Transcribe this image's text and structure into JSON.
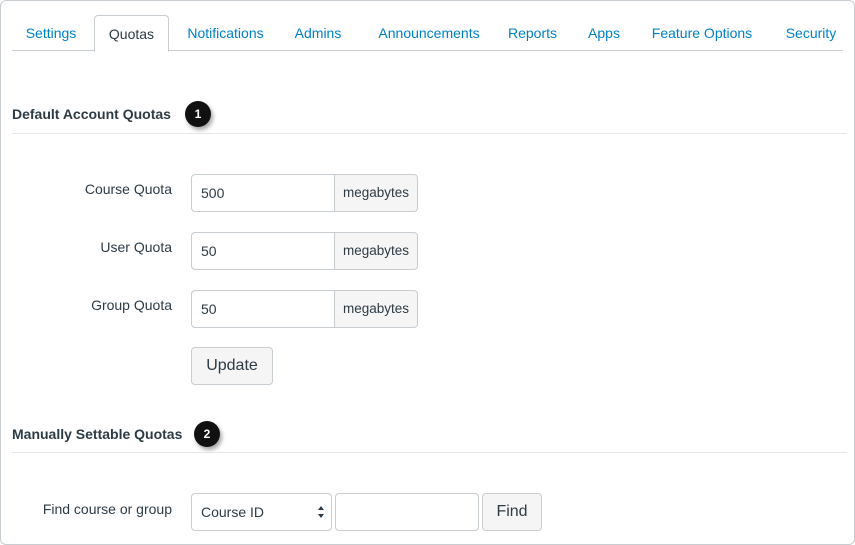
{
  "tabs": [
    {
      "label": "Settings"
    },
    {
      "label": "Quotas",
      "active": true
    },
    {
      "label": "Notifications"
    },
    {
      "label": "Admins"
    },
    {
      "label": "Announcements"
    },
    {
      "label": "Reports"
    },
    {
      "label": "Apps"
    },
    {
      "label": "Feature Options"
    },
    {
      "label": "Security"
    }
  ],
  "default_quotas": {
    "title": "Default Account Quotas",
    "badge": "1",
    "rows": [
      {
        "label": "Course Quota",
        "value": "500",
        "unit": "megabytes"
      },
      {
        "label": "User Quota",
        "value": "50",
        "unit": "megabytes"
      },
      {
        "label": "Group Quota",
        "value": "50",
        "unit": "megabytes"
      }
    ],
    "update_label": "Update"
  },
  "manual_quotas": {
    "title": "Manually Settable Quotas",
    "badge": "2",
    "find_label": "Find course or group",
    "select_value": "Course ID",
    "find_input_value": "",
    "find_button_label": "Find"
  },
  "colors": {
    "link": "#0081c6",
    "text": "#2d3b45",
    "border": "#c7cdd1",
    "badge": "#111111"
  }
}
